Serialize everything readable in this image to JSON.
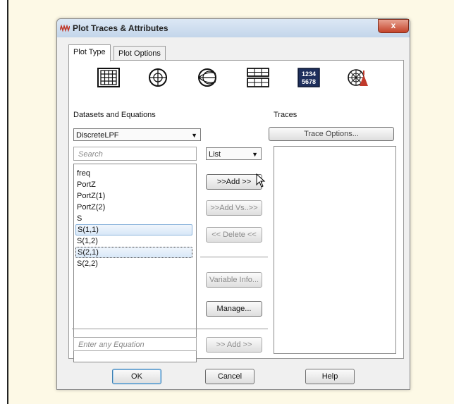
{
  "window": {
    "title": "Plot Traces & Attributes",
    "close_label": "x"
  },
  "tabs": [
    {
      "label": "Plot Type"
    },
    {
      "label": "Plot Options"
    }
  ],
  "plot_types": [
    {
      "icon": "rectangular-grid-icon"
    },
    {
      "icon": "polar-plot-icon"
    },
    {
      "icon": "smith-chart-icon"
    },
    {
      "icon": "stacked-plot-icon"
    },
    {
      "icon": "list-display-icon",
      "text_top": "1234",
      "text_bottom": "5678"
    },
    {
      "icon": "antenna-plot-icon"
    }
  ],
  "datasets": {
    "label": "Datasets and Equations",
    "selected": "DiscreteLPF",
    "search_placeholder": "Search",
    "view_mode": "List",
    "variables": [
      {
        "name": "freq",
        "state": "normal"
      },
      {
        "name": "PortZ",
        "state": "normal"
      },
      {
        "name": "PortZ(1)",
        "state": "normal"
      },
      {
        "name": "PortZ(2)",
        "state": "normal"
      },
      {
        "name": "S",
        "state": "normal"
      },
      {
        "name": "S(1,1)",
        "state": "selected"
      },
      {
        "name": "S(1,2)",
        "state": "normal"
      },
      {
        "name": "S(2,1)",
        "state": "focused"
      },
      {
        "name": "S(2,2)",
        "state": "normal"
      }
    ],
    "equation_placeholder": "Enter any Equation"
  },
  "actions": {
    "add": ">>Add >>",
    "add_vs": ">>Add Vs..>>",
    "delete": "<< Delete <<",
    "variable_info": "Variable Info...",
    "manage": "Manage...",
    "add_equation": ">> Add >>"
  },
  "traces": {
    "label": "Traces",
    "options_button": "Trace Options..."
  },
  "footer": {
    "ok": "OK",
    "cancel": "Cancel",
    "help": "Help"
  }
}
